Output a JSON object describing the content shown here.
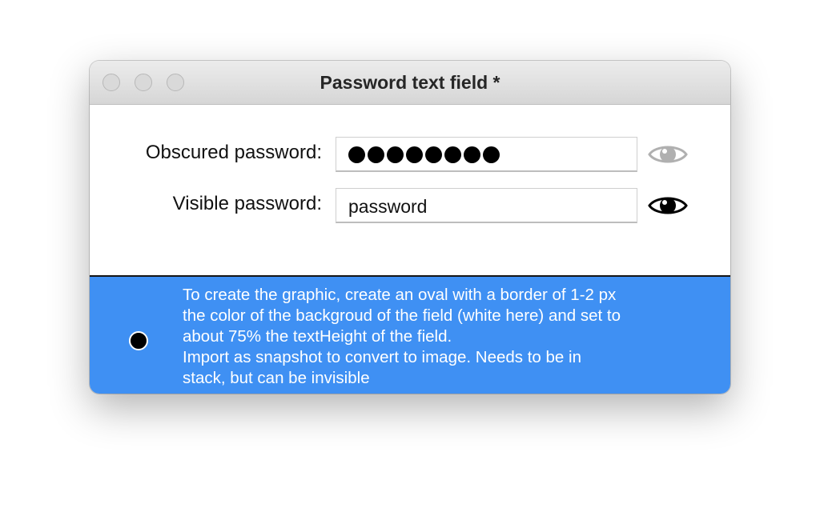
{
  "window": {
    "title": "Password text field *"
  },
  "form": {
    "obscured_label": "Obscured password:",
    "obscured_dot_count": 8,
    "obscured_toggle_icon": "eye-icon",
    "obscured_toggle_state": "inactive",
    "visible_label": "Visible password:",
    "visible_value": "password",
    "visible_toggle_icon": "eye-icon",
    "visible_toggle_state": "active"
  },
  "footer": {
    "background_color": "#3f90f3",
    "help_lines": [
      "To create the graphic, create an oval with a border of 1-2 px",
      "the color of the backgroud of the field (white here) and set to",
      "about 75% the textHeight of the field.",
      "Import as snapshot to convert to image. Needs to be in",
      "stack, but can be invisible"
    ]
  },
  "colors": {
    "eye_inactive": "#b0b0b0",
    "eye_active": "#000000"
  }
}
